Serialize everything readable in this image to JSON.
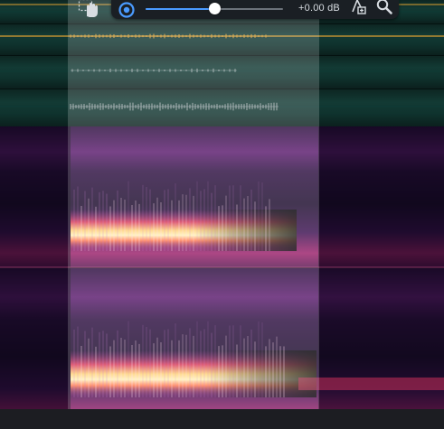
{
  "toolbar": {
    "gain_readout": "+0.00 dB",
    "gain_level": 0.5,
    "accent": "#4a9bff",
    "icons": [
      "hand-move-icon",
      "power-toggle-icon",
      "add-marker-icon",
      "zoom-icon"
    ]
  },
  "tracks": {
    "count": 4,
    "colors": [
      "#e0a030",
      "#e0a030",
      "#9aa6a8",
      "#9aa6a8"
    ]
  },
  "spectrogram": {
    "channels": 2,
    "palette": [
      "#0a0712",
      "#3b0f4f",
      "#8a1f7a",
      "#d83a5a",
      "#ff9a52",
      "#fff2b8"
    ]
  }
}
